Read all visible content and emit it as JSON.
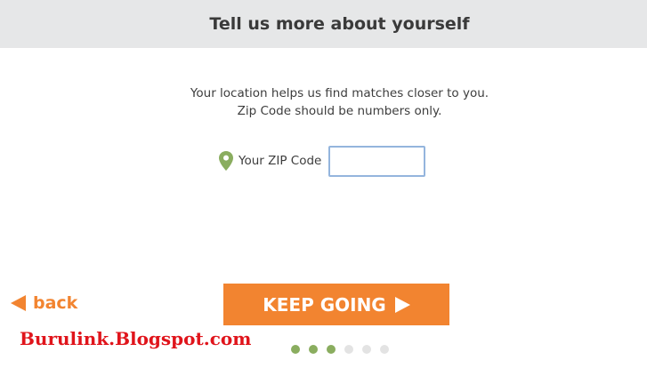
{
  "header": {
    "title": "Tell us more about yourself"
  },
  "intro": {
    "line1": "Your location helps us find matches closer to you.",
    "line2": "Zip Code should be numbers only."
  },
  "zip": {
    "label": "Your ZIP Code",
    "value": "",
    "icon": "location-pin-icon",
    "icon_color": "#8aad5f"
  },
  "nav": {
    "back_label": "back",
    "next_label": "KEEP GOING"
  },
  "watermark": "Burulink.Blogspot.com",
  "progress": {
    "steps_total": 6,
    "steps_completed": 3
  },
  "colors": {
    "accent": "#f28430",
    "completed_dot": "#8aad5f",
    "pending_dot": "#e3e3e3"
  }
}
